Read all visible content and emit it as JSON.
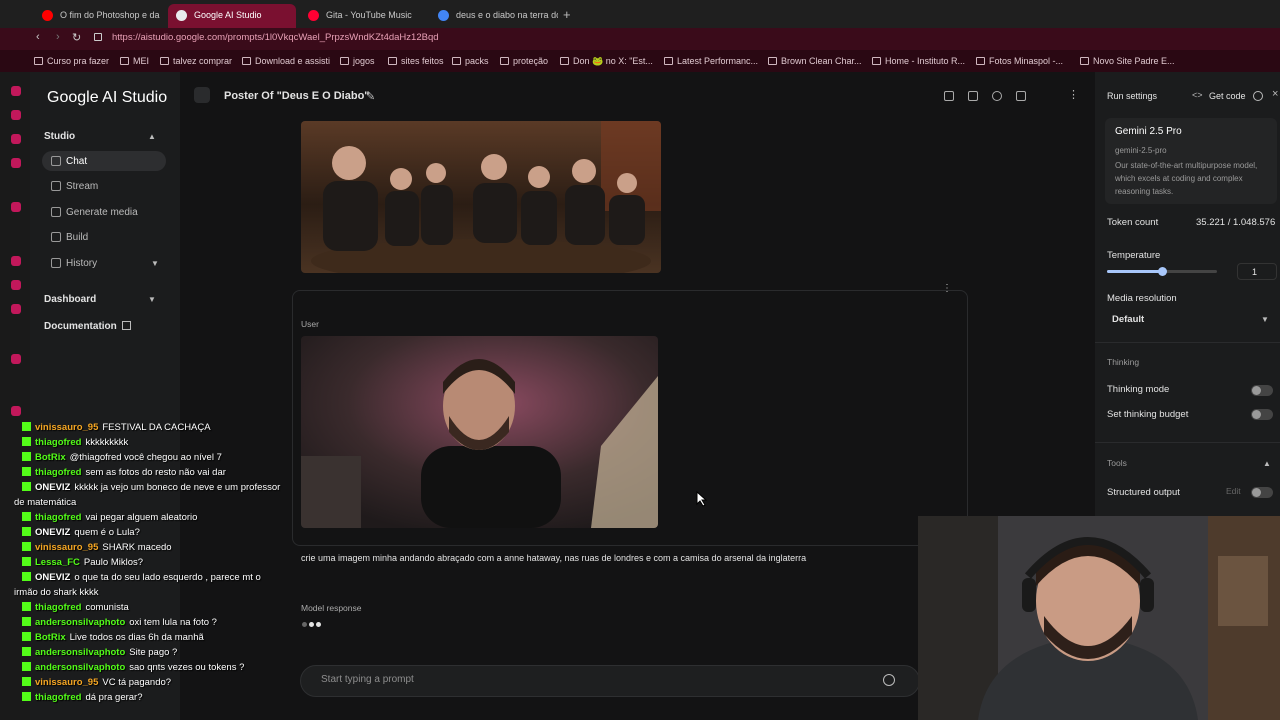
{
  "browser": {
    "tabs": [
      {
        "label": "O fim do Photoshop e da"
      },
      {
        "label": "Google AI Studio"
      },
      {
        "label": "Gita - YouTube Music"
      },
      {
        "label": "deus e o diabo na terra do"
      }
    ],
    "url": "https://aistudio.google.com/prompts/1l0VkqcWael_PrpzsWndKZt4daHz12Bqd",
    "bookmarks": [
      "Curso pra fazer",
      "MEI",
      "talvez comprar",
      "Download e assisti",
      "jogos",
      "sites feitos",
      "packs",
      "proteção",
      "Don 🐸 no X: \"Est...",
      "Latest Performanc...",
      "Brown Clean Char...",
      "Home - Instituto R...",
      "Fotos Minaspol -...",
      "Novo Site Padre E..."
    ]
  },
  "sidebar": {
    "logo": "Google AI Studio",
    "studio_label": "Studio",
    "items": [
      {
        "label": "Chat"
      },
      {
        "label": "Stream"
      },
      {
        "label": "Generate media"
      },
      {
        "label": "Build"
      },
      {
        "label": "History"
      }
    ],
    "dashboard_label": "Dashboard",
    "documentation_label": "Documentation"
  },
  "main": {
    "title": "Poster Of \"Deus E O Diabo\"",
    "user_label": "User",
    "prompt_text": "crie uma imagem minha andando abraçado com a anne hataway, nas ruas de londres e com a camisa do arsenal da inglaterra",
    "model_label": "Model response",
    "input_placeholder": "Start typing a prompt"
  },
  "settings": {
    "run_settings": "Run settings",
    "get_code": "Get code",
    "model_name": "Gemini 2.5 Pro",
    "model_id": "gemini-2.5-pro",
    "model_desc": "Our state-of-the-art multipurpose model, which excels at coding and complex reasoning tasks.",
    "token_label": "Token count",
    "token_value": "35.221 / 1.048.576",
    "temperature_label": "Temperature",
    "temperature_value": "1",
    "media_res_label": "Media resolution",
    "media_res_value": "Default",
    "thinking_label": "Thinking",
    "thinking_mode": "Thinking mode",
    "thinking_budget": "Set thinking budget",
    "tools_label": "Tools",
    "structured_output": "Structured output",
    "edit_label": "Edit"
  },
  "chat": [
    {
      "user": "vinissauro_95",
      "text": "FESTIVAL DA CACHAÇA",
      "color": "#f5a623"
    },
    {
      "user": "thiagofred",
      "text": "kkkkkkkkk",
      "color": "#53fc18"
    },
    {
      "user": "BotRix",
      "text": "@thiagofred você chegou ao nível 7",
      "color": "#53fc18"
    },
    {
      "user": "thiagofred",
      "text": "sem as fotos do resto não vai dar",
      "color": "#53fc18"
    },
    {
      "user": "ONEVIZ",
      "text": "kkkkk ja vejo um boneco de neve e um professor",
      "color": "#ffffff"
    },
    {
      "user": "",
      "text": "de matemática",
      "color": "#ffffff"
    },
    {
      "user": "thiagofred",
      "text": "vai pegar alguem aleatorio",
      "color": "#53fc18"
    },
    {
      "user": "ONEVIZ",
      "text": "quem é o Lula?",
      "color": "#ffffff"
    },
    {
      "user": "vinissauro_95",
      "text": "SHARK macedo",
      "color": "#f5a623"
    },
    {
      "user": "Lessa_FC",
      "text": "Paulo Miklos?",
      "color": "#53fc18"
    },
    {
      "user": "ONEVIZ",
      "text": "o que ta do seu lado esquerdo , parece mt o",
      "color": "#ffffff"
    },
    {
      "user": "",
      "text": "irmão do shark kkkk",
      "color": "#ffffff"
    },
    {
      "user": "thiagofred",
      "text": "comunista",
      "color": "#53fc18"
    },
    {
      "user": "andersonsilvaphoto",
      "text": "oxi tem lula na foto ?",
      "color": "#53fc18"
    },
    {
      "user": "BotRix",
      "text": "Live todos os dias 6h da manhã",
      "color": "#53fc18"
    },
    {
      "user": "andersonsilvaphoto",
      "text": "Site pago ?",
      "color": "#53fc18"
    },
    {
      "user": "andersonsilvaphoto",
      "text": "sao qnts vezes ou tokens ?",
      "color": "#53fc18"
    },
    {
      "user": "vinissauro_95",
      "text": "VC tá pagando?",
      "color": "#f5a623"
    },
    {
      "user": "thiagofred",
      "text": "dá pra gerar?",
      "color": "#53fc18"
    }
  ]
}
